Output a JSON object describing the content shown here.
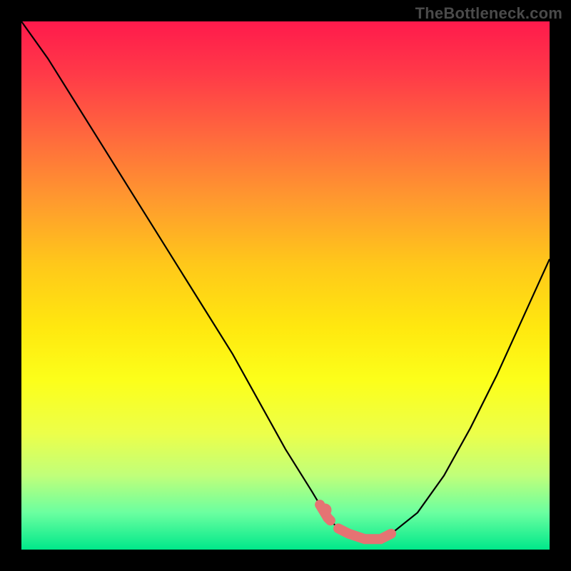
{
  "watermark": {
    "text": "TheBottleneck.com"
  },
  "colors": {
    "background": "#000000",
    "curve": "#000000",
    "highlight": "#e57373",
    "gradient_top": "#ff1a4c",
    "gradient_bottom": "#00e88a"
  },
  "chart_data": {
    "type": "line",
    "title": "",
    "xlabel": "",
    "ylabel": "",
    "xlim": [
      0,
      100
    ],
    "ylim": [
      0,
      100
    ],
    "x": [
      0,
      5,
      10,
      15,
      20,
      25,
      30,
      35,
      40,
      45,
      50,
      55,
      58,
      60,
      62,
      65,
      68,
      70,
      75,
      80,
      85,
      90,
      95,
      100
    ],
    "values": [
      100,
      93,
      85,
      77,
      69,
      61,
      53,
      45,
      37,
      28,
      19,
      11,
      6,
      4,
      3,
      2,
      2,
      3,
      7,
      14,
      23,
      33,
      44,
      55
    ],
    "highlight_ranges": [
      {
        "x0": 56.5,
        "x1": 58.5
      },
      {
        "x0": 60.0,
        "x1": 70.0
      }
    ],
    "highlight_dot": {
      "x": 57.5,
      "y": 7.5
    },
    "note": "x and values are percentages of the plot area. y=0 is the bottom green edge, y=100 is the top. Curve shows a bottleneck-style V where the minimum (~2%) sits around x≈62–68%."
  }
}
